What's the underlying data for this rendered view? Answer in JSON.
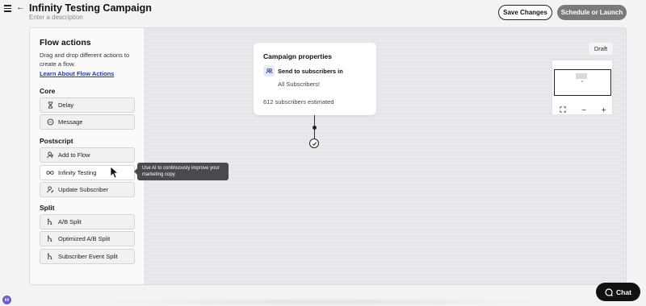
{
  "header": {
    "title": "Infinity Testing Campaign",
    "description_placeholder": "Enter a description",
    "save_label": "Save Changes",
    "launch_label": "Schedule or Launch"
  },
  "sidebar": {
    "title": "Flow actions",
    "description": "Drag and drop different actions to create a flow.",
    "learn_link": "Learn About Flow Actions",
    "sections": [
      {
        "label": "Core",
        "items": [
          {
            "label": "Delay",
            "icon": "hourglass-icon"
          },
          {
            "label": "Message",
            "icon": "message-icon"
          }
        ]
      },
      {
        "label": "Postscript",
        "items": [
          {
            "label": "Add to Flow",
            "icon": "add-user-icon"
          },
          {
            "label": "Infinity Testing",
            "icon": "infinity-icon"
          },
          {
            "label": "Update Subscriber",
            "icon": "user-edit-icon"
          }
        ]
      },
      {
        "label": "Split",
        "items": [
          {
            "label": "A/B Split",
            "icon": "split-icon"
          },
          {
            "label": "Optimized A/B Split",
            "icon": "split-icon"
          },
          {
            "label": "Subscriber Event Split",
            "icon": "split-icon"
          }
        ]
      }
    ]
  },
  "tooltip": {
    "text": "Use AI to continuously improve your marketing copy."
  },
  "card": {
    "title": "Campaign properties",
    "send_label": "Send to subscribers in",
    "segment": "All Subscribers!",
    "estimate": "612 subscribers estimated"
  },
  "status": {
    "draft": "Draft"
  },
  "chat": {
    "label": "Chat"
  },
  "colors": {
    "launch_button": "#7a7a7a",
    "link": "#1a3fa8",
    "chat_button": "#111111",
    "canvas": "#e9e9ed"
  }
}
